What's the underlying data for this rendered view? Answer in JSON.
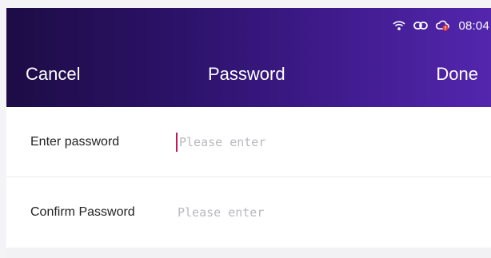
{
  "statusbar": {
    "icons": [
      "wifi-icon",
      "link-icon",
      "cloud-alert-icon"
    ],
    "time": "08:04"
  },
  "header": {
    "cancel_label": "Cancel",
    "title": "Password",
    "done_label": "Done"
  },
  "form": {
    "fields": [
      {
        "label": "Enter password",
        "placeholder": "Please enter",
        "value": ""
      },
      {
        "label": "Confirm Password",
        "placeholder": "Please enter",
        "value": ""
      }
    ]
  },
  "colors": {
    "header_start": "#1d0c45",
    "header_end": "#5326ad",
    "caret": "#c2185b",
    "placeholder": "#b9b9be"
  }
}
